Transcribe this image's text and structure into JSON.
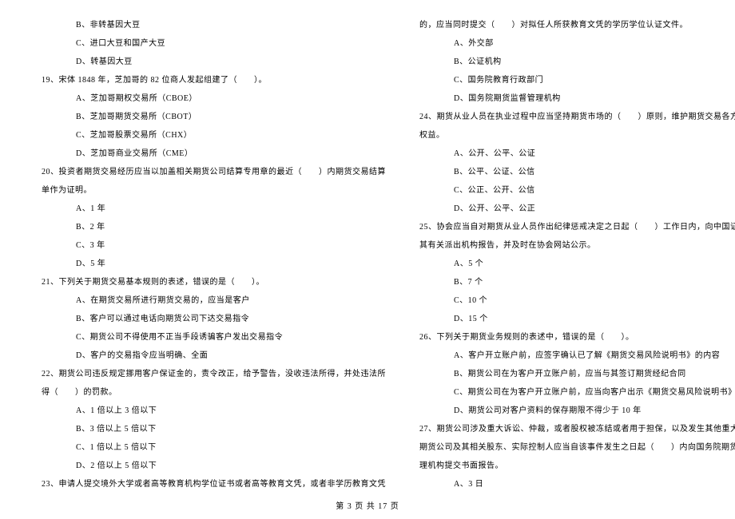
{
  "left": {
    "q18_options": [
      "B、非转基因大豆",
      "C、进口大豆和国产大豆",
      "D、转基因大豆"
    ],
    "q19": "19、宋体 1848 年，芝加哥的 82 位商人发起组建了（　　）。",
    "q19_options": [
      "A、芝加哥期权交易所（CBOE）",
      "B、芝加哥期货交易所（CBOT）",
      "C、芝加哥股票交易所（CHX）",
      "D、芝加哥商业交易所（CME）"
    ],
    "q20_line1": "20、投资者期货交易经历应当以加盖相关期货公司结算专用章的最近（　　）内期货交易结算",
    "q20_line2": "单作为证明。",
    "q20_options": [
      "A、1 年",
      "B、2 年",
      "C、3 年",
      "D、5 年"
    ],
    "q21": "21、下列关于期货交易基本规则的表述，错误的是（　　）。",
    "q21_options": [
      "A、在期货交易所进行期货交易的，应当是客户",
      "B、客户可以通过电话向期货公司下达交易指令",
      "C、期货公司不得使用不正当手段诱骗客户发出交易指令",
      "D、客户的交易指令应当明确、全面"
    ],
    "q22_line1": "22、期货公司违反规定挪用客户保证金的，责令改正，给予警告，没收违法所得，并处违法所",
    "q22_line2": "得（　　）的罚款。",
    "q22_options": [
      "A、1 倍以上 3 倍以下",
      "B、3 倍以上 5 倍以下",
      "C、1 倍以上 5 倍以下",
      "D、2 倍以上 5 倍以下"
    ],
    "q23": "23、申请人提交境外大学或者高等教育机构学位证书或者高等教育文凭，或者非学历教育文凭"
  },
  "right": {
    "q23_cont": "的，应当同时提交（　　）对拟任人所获教育文凭的学历学位认证文件。",
    "q23_options": [
      "A、外交部",
      "B、公证机构",
      "C、国务院教育行政部门",
      "D、国务院期货监督管理机构"
    ],
    "q24_line1": "24、期货从业人员在执业过程中应当坚持期货市场的（　　）原则，维护期货交易各方的合法",
    "q24_line2": "权益。",
    "q24_options": [
      "A、公开、公平、公证",
      "B、公平、公证、公信",
      "C、公正、公开、公信",
      "D、公开、公平、公正"
    ],
    "q25_line1": "25、协会应当自对期货从业人员作出纪律惩戒决定之日起（　　）工作日内，向中国证监会及",
    "q25_line2": "其有关派出机构报告，并及时在协会网站公示。",
    "q25_options": [
      "A、5 个",
      "B、7 个",
      "C、10 个",
      "D、15 个"
    ],
    "q26": "26、下列关于期货业务规则的表述中，错误的是（　　）。",
    "q26_options": [
      "A、客户开立账户前，应签字确认已了解《期货交易风险说明书》的内容",
      "B、期货公司在为客户开立账户前，应当与其签订期货经纪合同",
      "C、期货公司在为客户开立账户前，应当向客户出示《期货交易风险说明书》",
      "D、期货公司对客户资料的保存期限不得少于 10 年"
    ],
    "q27_line1": "27、期货公司涉及重大诉讼、仲裁，或者股权被冻结或者用于担保，以及发生其他重大事件时，",
    "q27_line2": "期货公司及其相关股东、实际控制人应当自该事件发生之日起（　　）内向国务院期货监督管",
    "q27_line3": "理机构提交书面报告。",
    "q27_options": [
      "A、3 日"
    ]
  },
  "footer": "第 3 页 共 17 页"
}
